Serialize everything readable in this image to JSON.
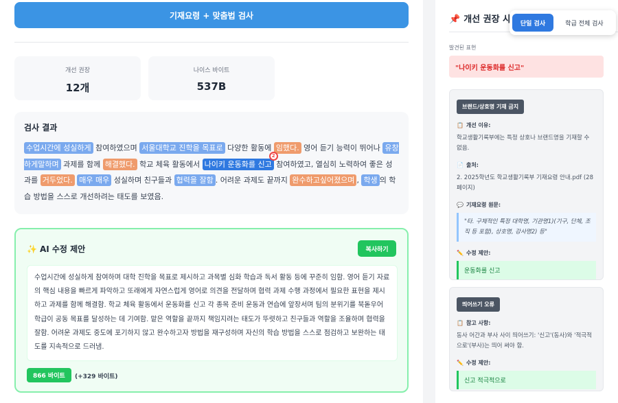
{
  "main": {
    "check_button": "기재요령 + 맞춤법 검사",
    "stats": [
      {
        "label": "개선 권장",
        "value": "12개"
      },
      {
        "label": "나이스 바이트",
        "value": "537B"
      }
    ],
    "result": {
      "title": "검사 결과",
      "segments": [
        {
          "text": "수업시간에 성실하게",
          "hl": "blue"
        },
        {
          "text": " 참여하였으며 "
        },
        {
          "text": "서울대학교 진학을 목표로",
          "hl": "blue"
        },
        {
          "text": " 다양한 활동에 "
        },
        {
          "text": "임했다.",
          "hl": "orange"
        },
        {
          "text": " 영어 듣기 능력이 뛰어나 "
        },
        {
          "text": "유창하게말하며",
          "hl": "blue"
        },
        {
          "text": " 과제를 함께 "
        },
        {
          "text": "해결했다.",
          "hl": "orange"
        },
        {
          "text": " 학교 체육 활동에서 "
        },
        {
          "text": "나이키 운동화를 신고",
          "hl": "dark",
          "badge": "2"
        },
        {
          "text": " 참여하였고, 열심히 노력하여 좋은 성과를 "
        },
        {
          "text": "거두었다.",
          "hl": "orange"
        },
        {
          "text": " "
        },
        {
          "text": "매우 매우",
          "hl": "blue"
        },
        {
          "text": " 성실하며 친구들과 "
        },
        {
          "text": "협력을 잘함",
          "hl": "blue"
        },
        {
          "text": ". 어려운 과제도 끝까지 "
        },
        {
          "text": "완수하고싶어졌으며",
          "hl": "orange"
        },
        {
          "text": ", "
        },
        {
          "text": "학생",
          "hl": "blue"
        },
        {
          "text": "의 학습 방법을 스스로 개선하려는 태도를 보였음."
        }
      ]
    },
    "ai": {
      "spark_icon": "✨",
      "title": "AI 수정 제안",
      "copy_label": "복사하기",
      "text": "수업시간에 성실하게 참여하며 대학 진학을 목표로 제시하고 과목별 심화 학습과 독서 활동 등에 꾸준히 임함. 영어 듣기 자료의 핵심 내용을 빠르게 파악하고 또래에게 자연스럽게 영어로 의견을 전달하며 협력 과제 수행 과정에서 필요한 표현을 제시하고 과제를 함께 해결함. 학교 체육 활동에서 운동화를 신고 각 종목 준비 운동과 연습에 앞장서며 팀의 분위기를 북돋우어 학급이 공동 목표를 달성하는 데 기여함. 맡은 역할을 끝까지 책임지려는 태도가 뚜렷하고 친구들과 역할을 조율하며 협력을 잘함. 어려운 과제도 중도에 포기하지 않고 완수하고자 방법을 재구성하며 자신의 학습 방법을 스스로 점검하고 보완하는 태도를 지속적으로 드러냄.",
      "bytes": "866 바이트",
      "bytes_diff": "(+329 바이트)"
    }
  },
  "sidebar": {
    "pin_icon": "📌",
    "title": "개선 권장 사항",
    "found_label": "발견된 표현",
    "found_value": "\"나이키 운동화를 신고\"",
    "cards": [
      {
        "tag": "브랜드/상호명 기재 금지",
        "sections": [
          {
            "icon": "📋",
            "label": "개선 이유:",
            "body": "학교생활기록부에는 특정 상호나 브랜드명을 기재할 수 없음."
          },
          {
            "icon": "📄",
            "label": "출처:",
            "body": "2. 2025학년도 학교생활기록부 기재요령 안내.pdf (28페이지)"
          },
          {
            "icon": "💬",
            "label": "기재요령 원문:",
            "quote": "\"타. 구체적인 특정 대학명, 기관명1)(기구, 단체, 조직 등 포함), 상호명, 강사명2) 등\""
          },
          {
            "icon": "✏️",
            "label": "수정 제안:",
            "fix": "운동화를 신고"
          }
        ]
      },
      {
        "tag": "띄어쓰기 오류",
        "sections": [
          {
            "icon": "📋",
            "label": "참고 사항:",
            "body": "동사 어간과 부사 사이 띄어쓰기: '신고'(동사)와 '적극적으로'(부사)는 띄어 써야 함."
          },
          {
            "icon": "✏️",
            "label": "수정 제안:",
            "fix": "신고 적극적으로"
          }
        ]
      }
    ]
  },
  "toggle": {
    "single": "단일 검사",
    "all": "학급 전체 검사"
  }
}
